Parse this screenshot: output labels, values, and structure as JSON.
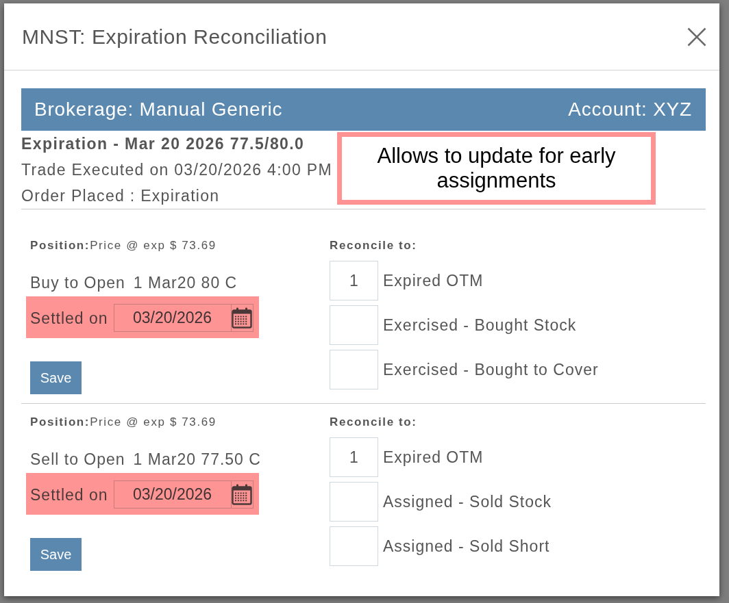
{
  "window": {
    "title": "MNST: Expiration Reconciliation"
  },
  "banner": {
    "brokerage": "Brokerage: Manual Generic",
    "account": "Account: XYZ"
  },
  "summary": {
    "heading": "Expiration - Mar 20 2026 77.5/80.0",
    "lines": [
      "Trade Executed on 03/20/2026 4:00 PM",
      "Order Placed : Expiration"
    ]
  },
  "callout": {
    "text": "Allows to update for early assignments"
  },
  "positions": [
    {
      "position_info": "**Position:**Price @ exp $ 73.69",
      "action": "Buy to Open",
      "contract": "1 Mar20 80 C",
      "settled_label": "Settled on",
      "settled_date": "03/20/2026",
      "highlighted": true,
      "save_label": "Save",
      "reconcile_heading": "Reconcile to:",
      "outcomes": [
        {
          "value": "1",
          "label": "Expired OTM"
        },
        {
          "label": "Exercised - Bought Stock"
        },
        {
          "label": "Exercised - Bought to Cover"
        }
      ]
    },
    {
      "position_info": "**Position:**Price @ exp $ 73.69",
      "action": "Sell to Open",
      "contract": "1 Mar20 77.50 C",
      "settled_label": "Settled on",
      "settled_date": "03/20/2026",
      "highlighted": true,
      "save_label": "Save",
      "reconcile_heading": "Reconcile to:",
      "outcomes": [
        {
          "value": "1",
          "label": "Expired OTM"
        },
        {
          "label": "Assigned - Sold Stock"
        },
        {
          "label": "Assigned - Sold Short"
        }
      ]
    }
  ]
}
